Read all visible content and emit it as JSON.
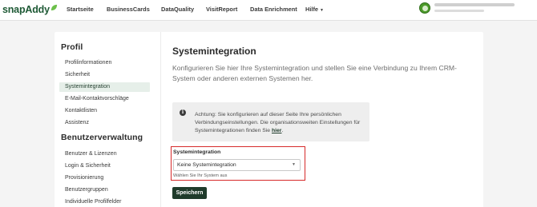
{
  "header": {
    "logo_text": "snapAddy",
    "nav": [
      {
        "label": "Startseite"
      },
      {
        "label": "BusinessCards"
      },
      {
        "label": "DataQuality"
      },
      {
        "label": "VisitReport"
      },
      {
        "label": "Data Enrichment"
      },
      {
        "label": "Hilfe"
      }
    ]
  },
  "sidebar": {
    "profile_heading": "Profil",
    "profile_items": [
      {
        "label": "Profilinformationen"
      },
      {
        "label": "Sicherheit"
      },
      {
        "label": "Systemintegration"
      },
      {
        "label": "E-Mail-Kontaktvorschläge"
      },
      {
        "label": "Kontaktlisten"
      },
      {
        "label": "Assistenz"
      }
    ],
    "admin_heading": "Benutzerverwaltung",
    "admin_items": [
      {
        "label": "Benutzer & Lizenzen"
      },
      {
        "label": "Login & Sicherheit"
      },
      {
        "label": "Provisionierung"
      },
      {
        "label": "Benutzergruppen"
      },
      {
        "label": "Individuelle Profilfelder"
      }
    ]
  },
  "main": {
    "title": "Systemintegration",
    "description": "Konfigurieren Sie hier Ihre Systemintegration und stellen Sie eine Verbindung zu Ihrem CRM-System oder anderen externen Systemen her.",
    "alert": {
      "text": "Achtung: Sie konfigurieren auf dieser Seite Ihre persönlichen Verbindungseinstellungen. Die organisationsweiten Einstellungen für Systemintegrationen finden Sie",
      "link": "hier",
      "suffix": "."
    },
    "field": {
      "label": "Systemintegration",
      "selected": "Keine Systemintegration",
      "hint": "Wählen Sie Ihr System aus"
    },
    "save_label": "Speichern"
  },
  "colors": {
    "brand": "#1f3b2b",
    "highlight_border": "#d62a2a",
    "active_item_bg": "#e6efe9"
  }
}
